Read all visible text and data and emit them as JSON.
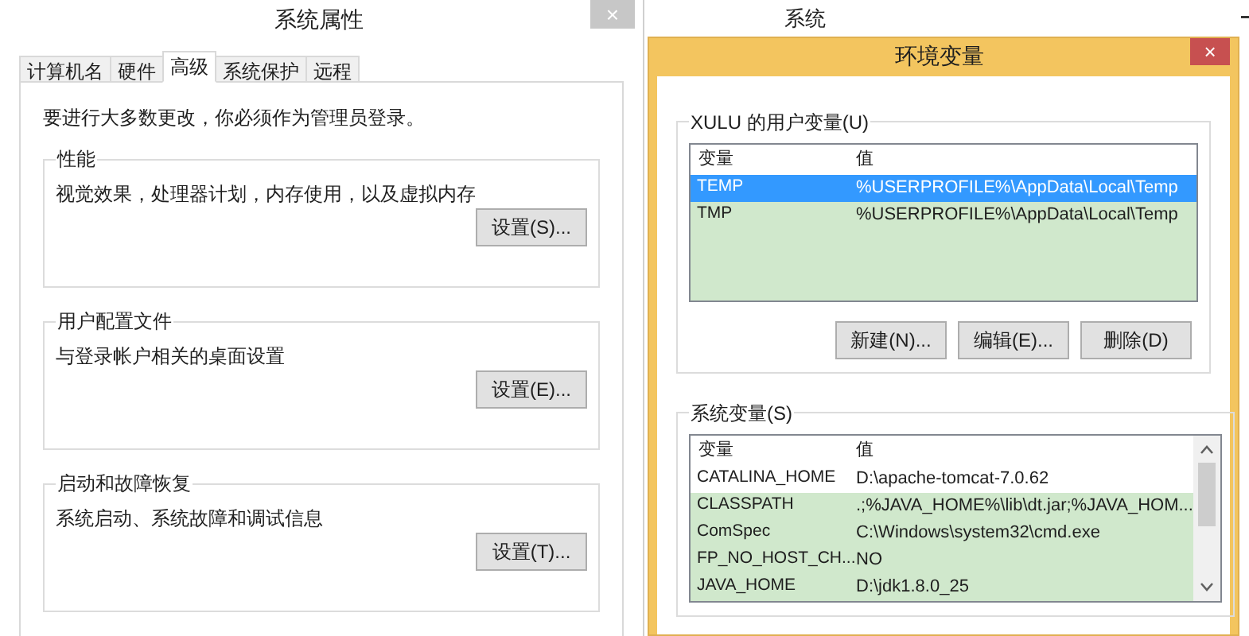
{
  "system_properties": {
    "title": "系统属性",
    "close": "×",
    "tabs": [
      {
        "label": "计算机名",
        "selected": false
      },
      {
        "label": "硬件",
        "selected": false
      },
      {
        "label": "高级",
        "selected": true
      },
      {
        "label": "系统保护",
        "selected": false
      },
      {
        "label": "远程",
        "selected": false
      }
    ],
    "notice": "要进行大多数更改，你必须作为管理员登录。",
    "groups": [
      {
        "title": "性能",
        "description": "视觉效果，处理器计划，内存使用，以及虚拟内存",
        "button": "设置(S)..."
      },
      {
        "title": "用户配置文件",
        "description": "与登录帐户相关的桌面设置",
        "button": "设置(E)..."
      },
      {
        "title": "启动和故障恢复",
        "description": "系统启动、系统故障和调试信息",
        "button": "设置(T)..."
      }
    ]
  },
  "system_window": {
    "title": "系统"
  },
  "env_dialog": {
    "title": "环境变量",
    "close": "×",
    "user_vars": {
      "label": "XULU 的用户变量(U)",
      "columns": [
        "变量",
        "值"
      ],
      "rows": [
        {
          "name": "TEMP",
          "value": "%USERPROFILE%\\AppData\\Local\\Temp",
          "selected": true
        },
        {
          "name": "TMP",
          "value": "%USERPROFILE%\\AppData\\Local\\Temp",
          "selected": false,
          "shaded": true
        }
      ],
      "buttons": [
        "新建(N)...",
        "编辑(E)...",
        "删除(D)"
      ]
    },
    "system_vars": {
      "label": "系统变量(S)",
      "columns": [
        "变量",
        "值"
      ],
      "rows": [
        {
          "name": "CATALINA_HOME",
          "value": "D:\\apache-tomcat-7.0.62",
          "selected": false,
          "shaded": false
        },
        {
          "name": "CLASSPATH",
          "value": ".;%JAVA_HOME%\\lib\\dt.jar;%JAVA_HOM...",
          "selected": false,
          "shaded": true
        },
        {
          "name": "ComSpec",
          "value": "C:\\Windows\\system32\\cmd.exe",
          "selected": false,
          "shaded": true
        },
        {
          "name": "FP_NO_HOST_CH...",
          "value": "NO",
          "selected": false,
          "shaded": true
        },
        {
          "name": "JAVA_HOME",
          "value": "D:\\jdk1.8.0_25",
          "selected": false,
          "shaded": true
        }
      ]
    }
  }
}
